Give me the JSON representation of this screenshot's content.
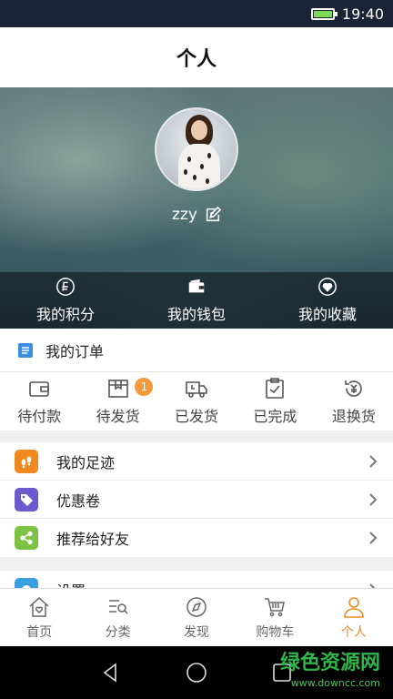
{
  "status_bar": {
    "time": "19:40",
    "colors": {
      "battery": "#7ed957"
    }
  },
  "header": {
    "title": "个人"
  },
  "profile": {
    "username": "zzy"
  },
  "hero_actions": [
    {
      "label": "我的积分",
      "icon": "points-icon"
    },
    {
      "label": "我的钱包",
      "icon": "wallet-icon"
    },
    {
      "label": "我的收藏",
      "icon": "favorite-heart-icon"
    }
  ],
  "orders": {
    "title": "我的订单",
    "items": [
      {
        "label": "待付款",
        "icon": "wallet-outline-icon"
      },
      {
        "label": "待发货",
        "icon": "box-icon",
        "badge": "1"
      },
      {
        "label": "已发货",
        "icon": "truck-icon"
      },
      {
        "label": "已完成",
        "icon": "clipboard-check-icon"
      },
      {
        "label": "退换货",
        "icon": "refund-icon"
      }
    ]
  },
  "menu": [
    {
      "label": "我的足迹",
      "icon": "footprint-icon",
      "color": "#f0891f"
    },
    {
      "label": "优惠卷",
      "icon": "coupon-tag-icon",
      "color": "#6a5acd"
    },
    {
      "label": "推荐给好友",
      "icon": "share-icon",
      "color": "#7cc142"
    }
  ],
  "menu2": [
    {
      "label": "设置",
      "icon": "settings-icon",
      "color": "#3aa0e0"
    }
  ],
  "tabs": [
    {
      "label": "首页",
      "icon": "home-heart-icon"
    },
    {
      "label": "分类",
      "icon": "category-search-icon"
    },
    {
      "label": "发现",
      "icon": "compass-icon"
    },
    {
      "label": "购物车",
      "icon": "cart-icon"
    },
    {
      "label": "个人",
      "icon": "person-icon",
      "active": true
    }
  ],
  "colors": {
    "accent": "#e98b2a",
    "badge": "#f59a3c"
  },
  "watermark": {
    "title": "绿色资源网",
    "url": "www.downcc.com"
  }
}
